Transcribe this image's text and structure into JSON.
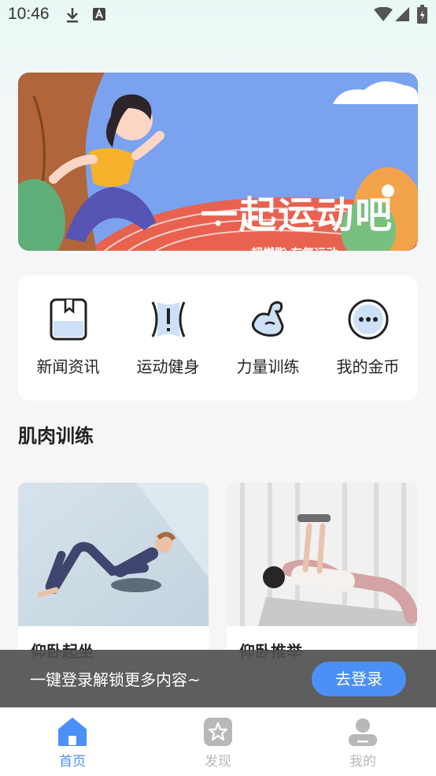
{
  "status_bar": {
    "time": "10:46"
  },
  "banner": {
    "title": "一起运动吧",
    "subtitle": "超燃脂 有氧运动"
  },
  "menu": {
    "items": [
      {
        "label": "新闻资讯",
        "icon": "book-icon"
      },
      {
        "label": "运动健身",
        "icon": "fitness-icon"
      },
      {
        "label": "力量训练",
        "icon": "muscle-arm-icon"
      },
      {
        "label": "我的金币",
        "icon": "more-dots-icon"
      }
    ]
  },
  "section": {
    "title": "肌肉训练"
  },
  "cards": [
    {
      "title": "仰卧起坐"
    },
    {
      "title": "仰卧推举"
    }
  ],
  "login_bar": {
    "text": "一键登录解锁更多内容~",
    "button": "去登录"
  },
  "tabbar": {
    "items": [
      {
        "label": "首页",
        "active": true
      },
      {
        "label": "发现",
        "active": false
      },
      {
        "label": "我的",
        "active": false
      }
    ],
    "active_color": "#4a90f6",
    "inactive_color": "#b8b8b8"
  }
}
